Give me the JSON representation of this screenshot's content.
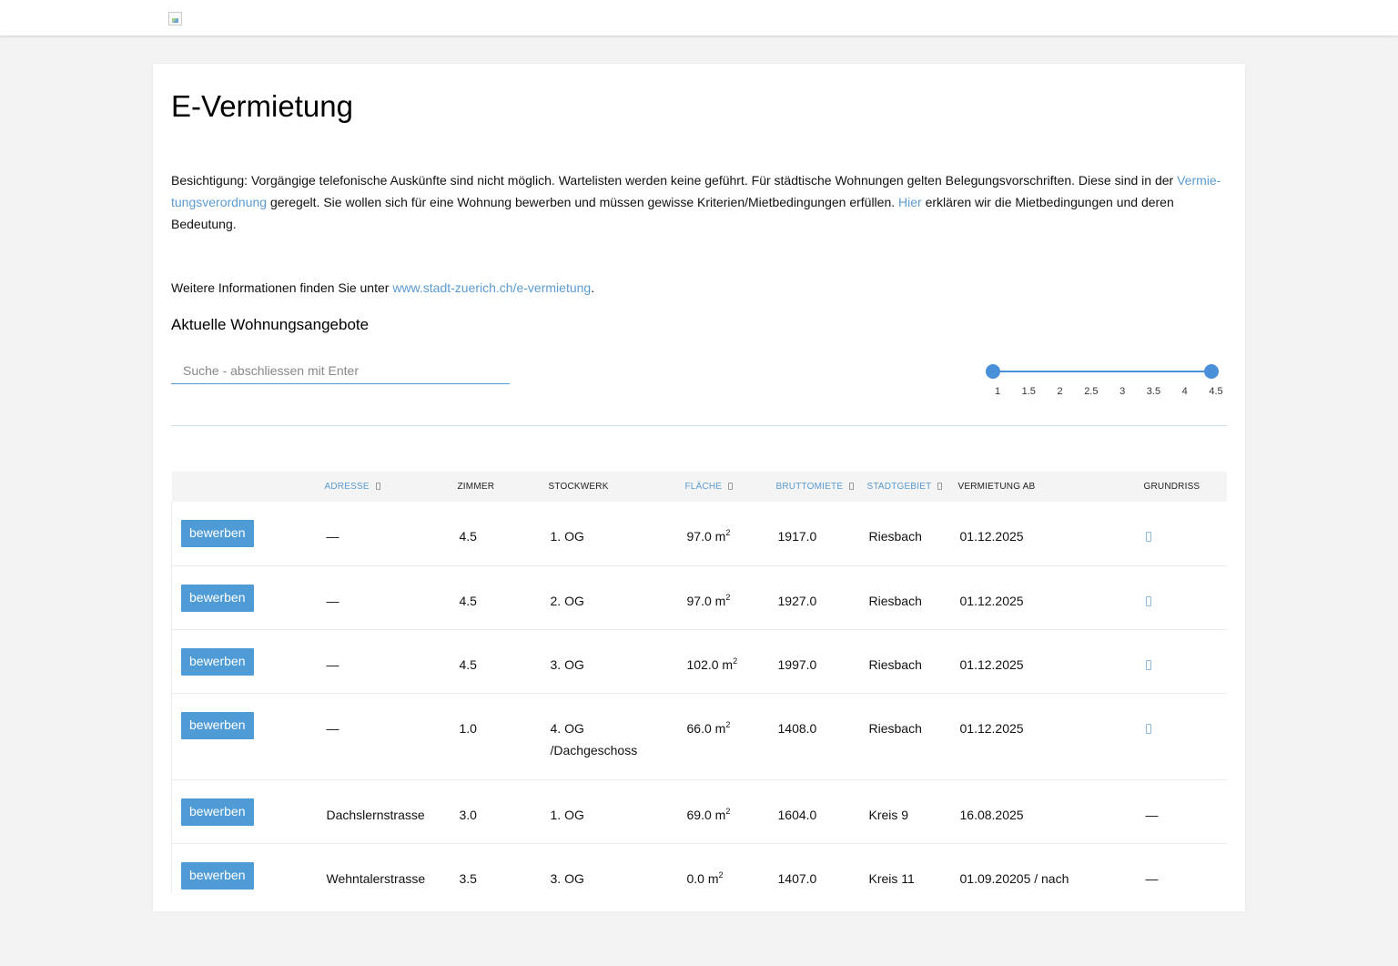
{
  "header": {
    "logo_icon": "broken-image-icon"
  },
  "page": {
    "title": "E-Vermietung",
    "intro": {
      "text1": "Besichtigung: Vorgängige telefonische Auskünfte sind nicht möglich. Wartelisten werden keine geführt. Für städtische Wohnungen gelten Belegungsvorschriften. Diese sind in der ",
      "link1": "Vermie-tungsverordnung",
      "text2": " geregelt. Sie wollen sich für eine Wohnung bewerben und müssen gewisse Kriterien/Mietbedingungen erfüllen. ",
      "link2": "Hier",
      "text3": " erklären wir die Mietbedingungen und deren Bedeutung."
    },
    "more": {
      "text1": "Weitere Informationen finden Sie unter ",
      "link": "www.stadt-zuerich.ch/e-vermietung",
      "text2": "."
    },
    "section_title": "Aktuelle Wohnungsangebote"
  },
  "search": {
    "placeholder": "Suche - abschliessen mit Enter",
    "value": ""
  },
  "room_slider": {
    "ticks": [
      "1",
      "1.5",
      "2",
      "2.5",
      "3",
      "3.5",
      "4",
      "4.5"
    ],
    "min_selected": 1,
    "max_selected": 4.5,
    "color": "#4a90d9"
  },
  "table": {
    "headers": {
      "adresse": "ADRESSE",
      "zimmer": "ZIMMER",
      "stockwerk": "STOCKWERK",
      "flaeche": "FLÄCHE",
      "bruttomiete": "BRUTTOMIETE",
      "stadtgebiet": "STADTGEBIET",
      "vermietung_ab": "VERMIETUNG AB",
      "grundriss": "GRUNDRISS"
    },
    "rows": [
      {
        "button": "bewerben",
        "adresse": "—",
        "zimmer": "4.5",
        "stockwerk": "1. OG",
        "flaeche": "97.0 m",
        "bruttomiete": "1917.0",
        "stadtgebiet": "Riesbach",
        "vermietung_ab": "01.12.2025",
        "grundriss": "floorplan-icon"
      },
      {
        "button": "bewerben",
        "adresse": "—",
        "zimmer": "4.5",
        "stockwerk": "2. OG",
        "flaeche": "97.0 m",
        "bruttomiete": "1927.0",
        "stadtgebiet": "Riesbach",
        "vermietung_ab": "01.12.2025",
        "grundriss": "floorplan-icon"
      },
      {
        "button": "bewerben",
        "adresse": "—",
        "zimmer": "4.5",
        "stockwerk": "3. OG",
        "flaeche": "102.0 m",
        "bruttomiete": "1997.0",
        "stadtgebiet": "Riesbach",
        "vermietung_ab": "01.12.2025",
        "grundriss": "floorplan-icon"
      },
      {
        "button": "bewerben",
        "adresse": "—",
        "zimmer": "1.0",
        "stockwerk": "4. OG /Dachgeschoss",
        "flaeche": "66.0 m",
        "bruttomiete": "1408.0",
        "stadtgebiet": "Riesbach",
        "vermietung_ab": "01.12.2025",
        "grundriss": "floorplan-icon"
      },
      {
        "button": "bewerben",
        "adresse": "Dachslernstrasse",
        "zimmer": "3.0",
        "stockwerk": "1. OG",
        "flaeche": "69.0 m",
        "bruttomiete": "1604.0",
        "stadtgebiet": "Kreis 9",
        "vermietung_ab": "16.08.2025",
        "grundriss": "—"
      },
      {
        "button": "bewerben",
        "adresse": "Wehntalerstrasse",
        "zimmer": "3.5",
        "stockwerk": "3. OG",
        "flaeche": "0.0 m",
        "bruttomiete": "1407.0",
        "stadtgebiet": "Kreis 11",
        "vermietung_ab": "01.09.20205 / nach",
        "grundriss": "—"
      }
    ],
    "area_superscript": "2"
  }
}
